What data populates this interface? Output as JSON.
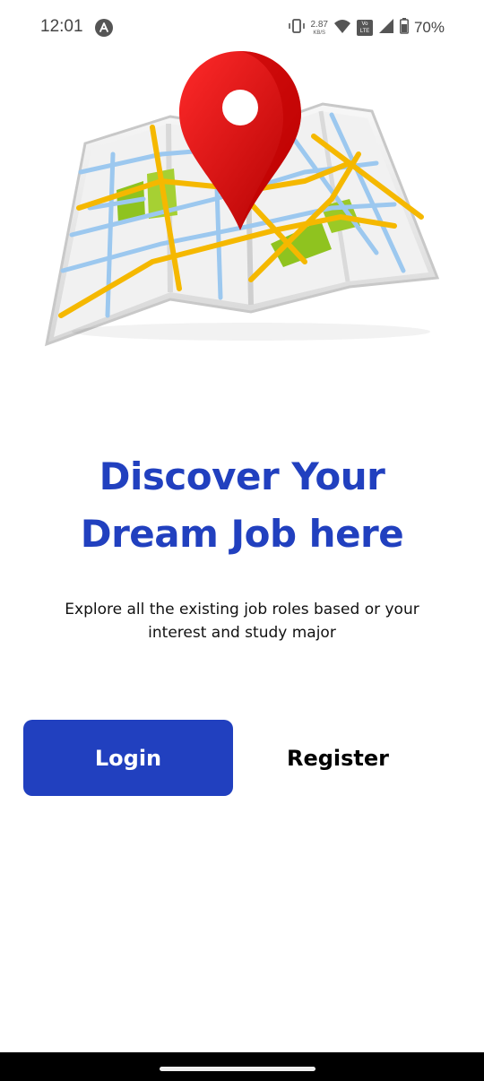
{
  "status_bar": {
    "time": "12:01",
    "network_speed_value": "2.87",
    "network_speed_unit": "KB/S",
    "volte_label_top": "Vo",
    "volte_label_bottom": "LTE",
    "battery": "70%"
  },
  "hero": {
    "icon": "map-location-pin-icon",
    "colors": {
      "pin": "#e00000",
      "roads_major": "#f5b800",
      "roads_minor": "#9cc8ef",
      "parks": "#8fc31f",
      "map_base": "#f2f2f2"
    }
  },
  "main": {
    "headline_line1": "Discover Your",
    "headline_line2": "Dream Job here",
    "subtext_line1": "Explore all the existing job roles based or your",
    "subtext_line2": "interest and study major"
  },
  "actions": {
    "login_label": "Login",
    "register_label": "Register"
  },
  "theme": {
    "primary": "#2140bf",
    "background": "#ffffff"
  }
}
